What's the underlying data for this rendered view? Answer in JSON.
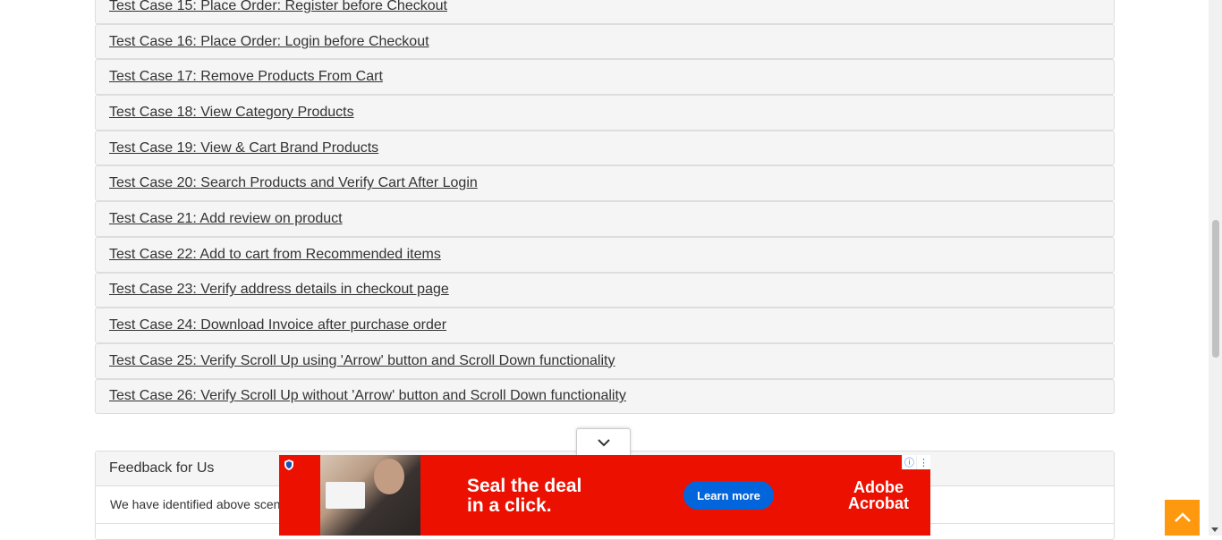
{
  "test_cases": [
    "Test Case 15: Place Order: Register before Checkout",
    "Test Case 16: Place Order: Login before Checkout",
    "Test Case 17: Remove Products From Cart",
    "Test Case 18: View Category Products",
    "Test Case 19: View & Cart Brand Products",
    "Test Case 20: Search Products and Verify Cart After Login",
    "Test Case 21: Add review on product",
    "Test Case 22: Add to cart from Recommended items",
    "Test Case 23: Verify address details in checkout page",
    "Test Case 24: Download Invoice after purchase order",
    "Test Case 25: Verify Scroll Up using 'Arrow' button and Scroll Down functionality",
    "Test Case 26: Verify Scroll Up without 'Arrow' button and Scroll Down functionality"
  ],
  "feedback": {
    "title": "Feedback for Us",
    "text": "We have identified above scen"
  },
  "ad": {
    "headline_line1": "Seal the deal",
    "headline_line2": "in a click.",
    "cta": "Learn more",
    "brand_line1": "Adobe",
    "brand_line2": "Acrobat",
    "background_color": "#eb1000",
    "cta_color": "#0265dc"
  },
  "icons": {
    "collapse_toggle": "chevron-down-icon",
    "scroll_up": "chevron-up-icon",
    "ad_info": "info-icon",
    "ad_menu": "kebab-menu-icon"
  },
  "colors": {
    "scroll_up_button": "#fe980f"
  }
}
